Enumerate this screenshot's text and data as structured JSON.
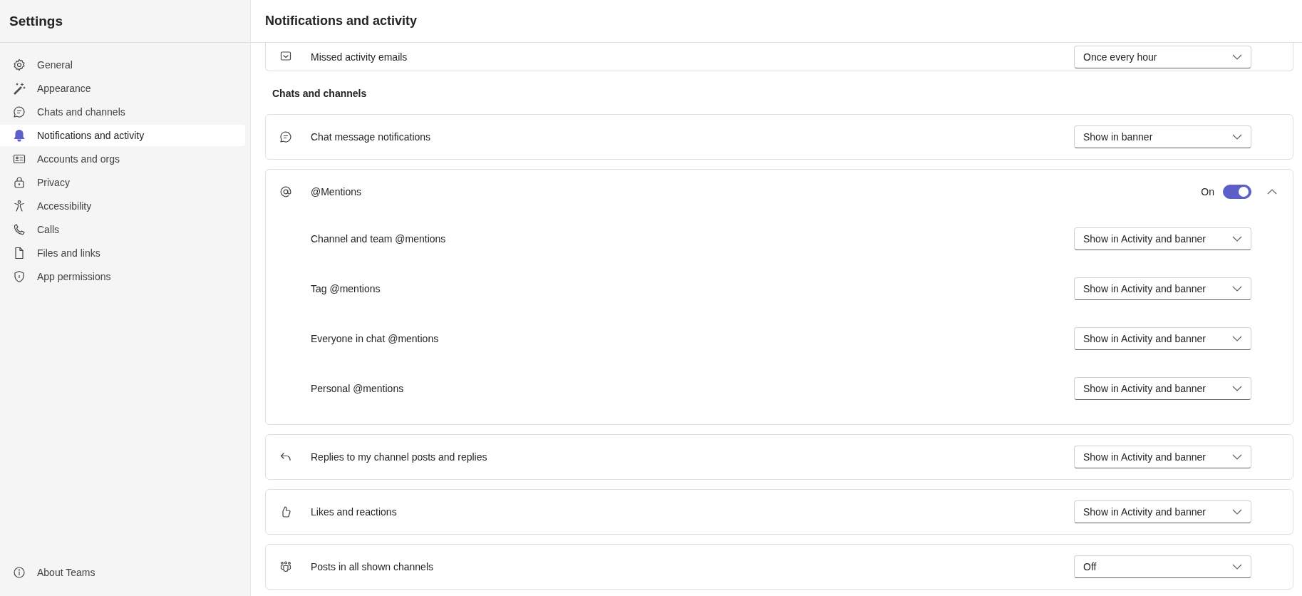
{
  "sidebar": {
    "title": "Settings",
    "items": [
      {
        "label": "General",
        "selected": false
      },
      {
        "label": "Appearance",
        "selected": false
      },
      {
        "label": "Chats and channels",
        "selected": false
      },
      {
        "label": "Notifications and activity",
        "selected": true
      },
      {
        "label": "Accounts and orgs",
        "selected": false
      },
      {
        "label": "Privacy",
        "selected": false
      },
      {
        "label": "Accessibility",
        "selected": false
      },
      {
        "label": "Calls",
        "selected": false
      },
      {
        "label": "Files and links",
        "selected": false
      },
      {
        "label": "App permissions",
        "selected": false
      }
    ],
    "footer": {
      "label": "About Teams"
    }
  },
  "page": {
    "title": "Notifications and activity"
  },
  "top_setting": {
    "label": "Missed activity emails",
    "value": "Once every hour"
  },
  "section": {
    "title": "Chats and channels"
  },
  "settings": [
    {
      "kind": "dropdown",
      "label": "Chat message notifications",
      "value": "Show in banner"
    },
    {
      "kind": "group",
      "label": "@Mentions",
      "toggle_label": "On",
      "on": true,
      "expanded": true,
      "children": [
        {
          "label": "Channel and team @mentions",
          "value": "Show in Activity and banner"
        },
        {
          "label": "Tag @mentions",
          "value": "Show in Activity and banner"
        },
        {
          "label": "Everyone in chat @mentions",
          "value": "Show in Activity and banner"
        },
        {
          "label": "Personal @mentions",
          "value": "Show in Activity and banner"
        }
      ]
    },
    {
      "kind": "dropdown",
      "label": "Replies to my channel posts and replies",
      "value": "Show in Activity and banner"
    },
    {
      "kind": "dropdown",
      "label": "Likes and reactions",
      "value": "Show in Activity and banner"
    },
    {
      "kind": "dropdown",
      "label": "Posts in all shown channels",
      "value": "Off"
    }
  ]
}
